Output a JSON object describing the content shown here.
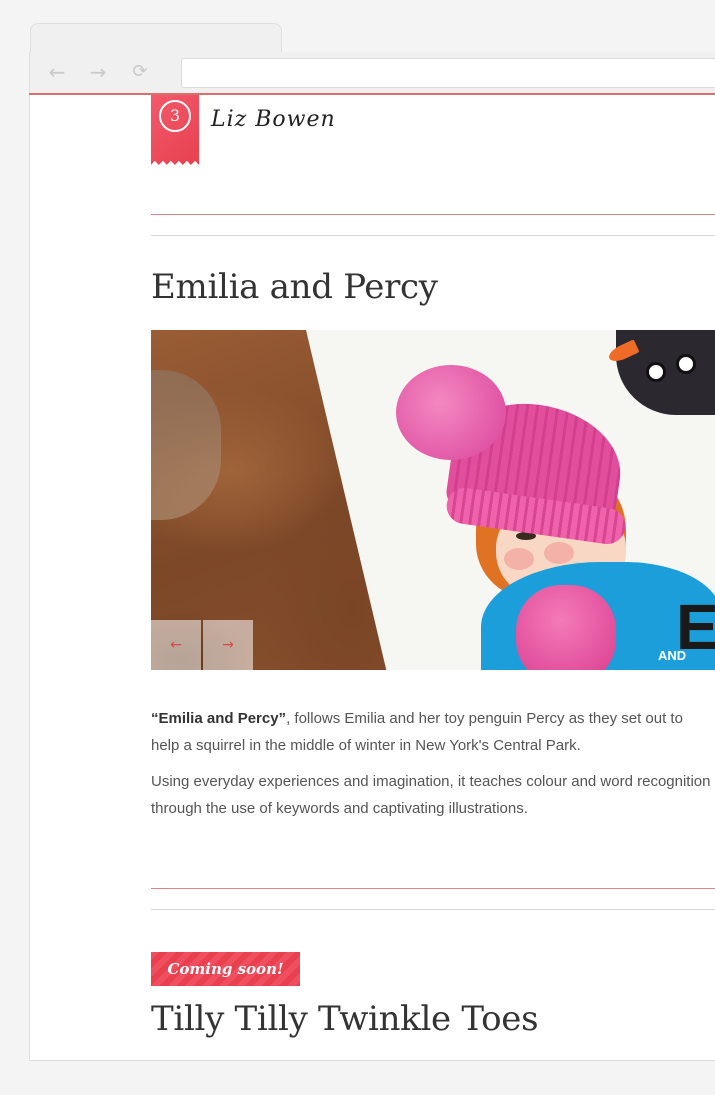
{
  "browser": {
    "address_value": ""
  },
  "site": {
    "logo_symbol": "3",
    "signature": "Liz Bowen"
  },
  "book1": {
    "title": "Emilia and Percy",
    "cover_title_partial": "E",
    "cover_subtitle_partial": "AND",
    "slider": {
      "prev_label": "←",
      "next_label": "→"
    },
    "desc1_strong": "“Emilia and Percy”",
    "desc1_rest": ", follows Emilia and her toy penguin Percy as they set out to help a squirrel in the middle of winter in New York's Central Park.",
    "desc2": "Using everyday experiences and imagination, it teaches colour and word recognition through the use of keywords and captivating illustrations."
  },
  "book2": {
    "badge": "Coming soon!",
    "title": "Tilly Tilly Twinkle Toes"
  },
  "colors": {
    "accent": "#e8404f",
    "rule_red": "#d98585",
    "text": "#333333"
  }
}
